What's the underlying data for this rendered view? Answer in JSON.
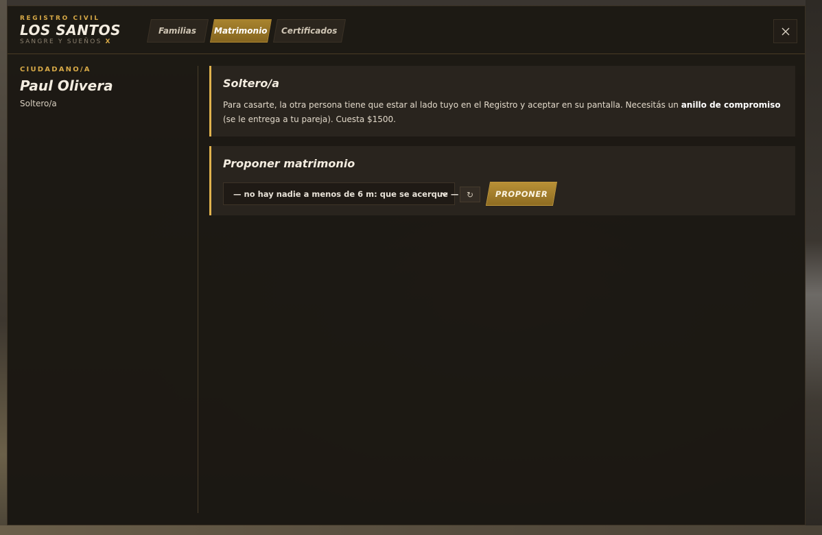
{
  "brand": {
    "kicker": "REGISTRO CIVIL",
    "title": "LOS SANTOS",
    "subtitle": "SANGRE Y SUEÑOS",
    "subtitle_accent": "X"
  },
  "tabs": [
    {
      "label": "Familias",
      "active": false
    },
    {
      "label": "Matrimonio",
      "active": true
    },
    {
      "label": "Certificados",
      "active": false
    }
  ],
  "close": {
    "icon": "close-icon"
  },
  "sidebar": {
    "kicker": "CIUDADANO/A",
    "name": "Paul Olivera",
    "status": "Soltero/a"
  },
  "status_card": {
    "title": "Soltero/a",
    "body_1": "Para casarte, la otra persona tiene que estar al lado tuyo en el Registro y aceptar en su pantalla. Necesitás un ",
    "body_bold": "anillo de compromiso",
    "body_2": " (se le entrega a tu pareja). Cuesta $1500."
  },
  "propose_card": {
    "title": "Proponer matrimonio",
    "select_value": "— no hay nadie a menos de 6 m: que se acerque —",
    "refresh_icon": "↻",
    "propose_label": "PROPONER"
  },
  "colors": {
    "accent": "#d7a947",
    "active_tab": "#a8832e",
    "card_border": "#e0b24e"
  }
}
